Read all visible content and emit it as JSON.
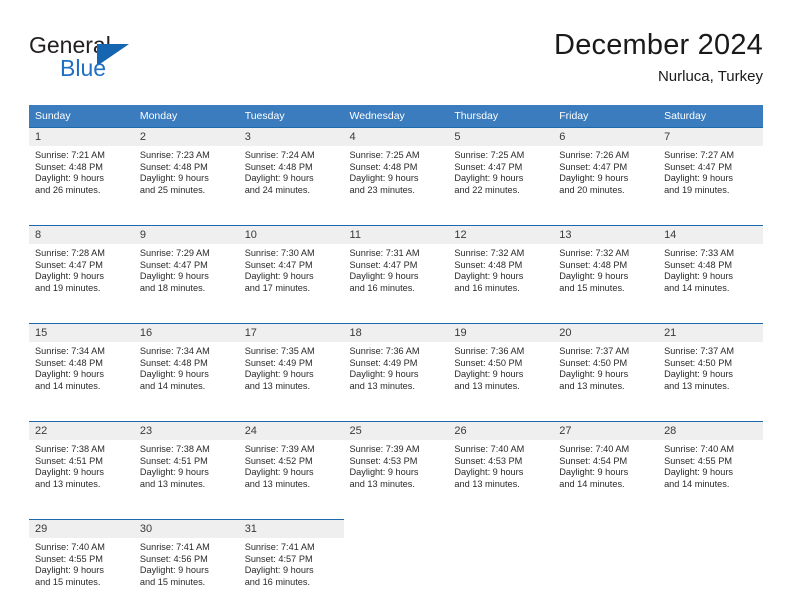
{
  "brand": {
    "name_part1": "General",
    "name_part2": "Blue",
    "flag_icon": "flag-triangle-icon"
  },
  "header": {
    "title": "December 2024",
    "location": "Nurluca, Turkey"
  },
  "colors": {
    "header_blue": "#3a7cbe",
    "cell_rule": "#1d69ad",
    "daynum_band": "#efefef",
    "brand_blue": "#1f6fc4",
    "text": "#1a1a1a"
  },
  "weekdays": [
    "Sunday",
    "Monday",
    "Tuesday",
    "Wednesday",
    "Thursday",
    "Friday",
    "Saturday"
  ],
  "labels": {
    "sunrise_prefix": "Sunrise:",
    "sunset_prefix": "Sunset:",
    "daylight_prefix": "Daylight:"
  },
  "weeks": [
    [
      {
        "day": "1",
        "sunrise": "Sunrise: 7:21 AM",
        "sunset": "Sunset: 4:48 PM",
        "daylight1": "Daylight: 9 hours",
        "daylight2": "and 26 minutes."
      },
      {
        "day": "2",
        "sunrise": "Sunrise: 7:23 AM",
        "sunset": "Sunset: 4:48 PM",
        "daylight1": "Daylight: 9 hours",
        "daylight2": "and 25 minutes."
      },
      {
        "day": "3",
        "sunrise": "Sunrise: 7:24 AM",
        "sunset": "Sunset: 4:48 PM",
        "daylight1": "Daylight: 9 hours",
        "daylight2": "and 24 minutes."
      },
      {
        "day": "4",
        "sunrise": "Sunrise: 7:25 AM",
        "sunset": "Sunset: 4:48 PM",
        "daylight1": "Daylight: 9 hours",
        "daylight2": "and 23 minutes."
      },
      {
        "day": "5",
        "sunrise": "Sunrise: 7:25 AM",
        "sunset": "Sunset: 4:47 PM",
        "daylight1": "Daylight: 9 hours",
        "daylight2": "and 22 minutes."
      },
      {
        "day": "6",
        "sunrise": "Sunrise: 7:26 AM",
        "sunset": "Sunset: 4:47 PM",
        "daylight1": "Daylight: 9 hours",
        "daylight2": "and 20 minutes."
      },
      {
        "day": "7",
        "sunrise": "Sunrise: 7:27 AM",
        "sunset": "Sunset: 4:47 PM",
        "daylight1": "Daylight: 9 hours",
        "daylight2": "and 19 minutes."
      }
    ],
    [
      {
        "day": "8",
        "sunrise": "Sunrise: 7:28 AM",
        "sunset": "Sunset: 4:47 PM",
        "daylight1": "Daylight: 9 hours",
        "daylight2": "and 19 minutes."
      },
      {
        "day": "9",
        "sunrise": "Sunrise: 7:29 AM",
        "sunset": "Sunset: 4:47 PM",
        "daylight1": "Daylight: 9 hours",
        "daylight2": "and 18 minutes."
      },
      {
        "day": "10",
        "sunrise": "Sunrise: 7:30 AM",
        "sunset": "Sunset: 4:47 PM",
        "daylight1": "Daylight: 9 hours",
        "daylight2": "and 17 minutes."
      },
      {
        "day": "11",
        "sunrise": "Sunrise: 7:31 AM",
        "sunset": "Sunset: 4:47 PM",
        "daylight1": "Daylight: 9 hours",
        "daylight2": "and 16 minutes."
      },
      {
        "day": "12",
        "sunrise": "Sunrise: 7:32 AM",
        "sunset": "Sunset: 4:48 PM",
        "daylight1": "Daylight: 9 hours",
        "daylight2": "and 16 minutes."
      },
      {
        "day": "13",
        "sunrise": "Sunrise: 7:32 AM",
        "sunset": "Sunset: 4:48 PM",
        "daylight1": "Daylight: 9 hours",
        "daylight2": "and 15 minutes."
      },
      {
        "day": "14",
        "sunrise": "Sunrise: 7:33 AM",
        "sunset": "Sunset: 4:48 PM",
        "daylight1": "Daylight: 9 hours",
        "daylight2": "and 14 minutes."
      }
    ],
    [
      {
        "day": "15",
        "sunrise": "Sunrise: 7:34 AM",
        "sunset": "Sunset: 4:48 PM",
        "daylight1": "Daylight: 9 hours",
        "daylight2": "and 14 minutes."
      },
      {
        "day": "16",
        "sunrise": "Sunrise: 7:34 AM",
        "sunset": "Sunset: 4:48 PM",
        "daylight1": "Daylight: 9 hours",
        "daylight2": "and 14 minutes."
      },
      {
        "day": "17",
        "sunrise": "Sunrise: 7:35 AM",
        "sunset": "Sunset: 4:49 PM",
        "daylight1": "Daylight: 9 hours",
        "daylight2": "and 13 minutes."
      },
      {
        "day": "18",
        "sunrise": "Sunrise: 7:36 AM",
        "sunset": "Sunset: 4:49 PM",
        "daylight1": "Daylight: 9 hours",
        "daylight2": "and 13 minutes."
      },
      {
        "day": "19",
        "sunrise": "Sunrise: 7:36 AM",
        "sunset": "Sunset: 4:50 PM",
        "daylight1": "Daylight: 9 hours",
        "daylight2": "and 13 minutes."
      },
      {
        "day": "20",
        "sunrise": "Sunrise: 7:37 AM",
        "sunset": "Sunset: 4:50 PM",
        "daylight1": "Daylight: 9 hours",
        "daylight2": "and 13 minutes."
      },
      {
        "day": "21",
        "sunrise": "Sunrise: 7:37 AM",
        "sunset": "Sunset: 4:50 PM",
        "daylight1": "Daylight: 9 hours",
        "daylight2": "and 13 minutes."
      }
    ],
    [
      {
        "day": "22",
        "sunrise": "Sunrise: 7:38 AM",
        "sunset": "Sunset: 4:51 PM",
        "daylight1": "Daylight: 9 hours",
        "daylight2": "and 13 minutes."
      },
      {
        "day": "23",
        "sunrise": "Sunrise: 7:38 AM",
        "sunset": "Sunset: 4:51 PM",
        "daylight1": "Daylight: 9 hours",
        "daylight2": "and 13 minutes."
      },
      {
        "day": "24",
        "sunrise": "Sunrise: 7:39 AM",
        "sunset": "Sunset: 4:52 PM",
        "daylight1": "Daylight: 9 hours",
        "daylight2": "and 13 minutes."
      },
      {
        "day": "25",
        "sunrise": "Sunrise: 7:39 AM",
        "sunset": "Sunset: 4:53 PM",
        "daylight1": "Daylight: 9 hours",
        "daylight2": "and 13 minutes."
      },
      {
        "day": "26",
        "sunrise": "Sunrise: 7:40 AM",
        "sunset": "Sunset: 4:53 PM",
        "daylight1": "Daylight: 9 hours",
        "daylight2": "and 13 minutes."
      },
      {
        "day": "27",
        "sunrise": "Sunrise: 7:40 AM",
        "sunset": "Sunset: 4:54 PM",
        "daylight1": "Daylight: 9 hours",
        "daylight2": "and 14 minutes."
      },
      {
        "day": "28",
        "sunrise": "Sunrise: 7:40 AM",
        "sunset": "Sunset: 4:55 PM",
        "daylight1": "Daylight: 9 hours",
        "daylight2": "and 14 minutes."
      }
    ],
    [
      {
        "day": "29",
        "sunrise": "Sunrise: 7:40 AM",
        "sunset": "Sunset: 4:55 PM",
        "daylight1": "Daylight: 9 hours",
        "daylight2": "and 15 minutes."
      },
      {
        "day": "30",
        "sunrise": "Sunrise: 7:41 AM",
        "sunset": "Sunset: 4:56 PM",
        "daylight1": "Daylight: 9 hours",
        "daylight2": "and 15 minutes."
      },
      {
        "day": "31",
        "sunrise": "Sunrise: 7:41 AM",
        "sunset": "Sunset: 4:57 PM",
        "daylight1": "Daylight: 9 hours",
        "daylight2": "and 16 minutes."
      },
      {
        "day": "",
        "sunrise": "",
        "sunset": "",
        "daylight1": "",
        "daylight2": ""
      },
      {
        "day": "",
        "sunrise": "",
        "sunset": "",
        "daylight1": "",
        "daylight2": ""
      },
      {
        "day": "",
        "sunrise": "",
        "sunset": "",
        "daylight1": "",
        "daylight2": ""
      },
      {
        "day": "",
        "sunrise": "",
        "sunset": "",
        "daylight1": "",
        "daylight2": ""
      }
    ]
  ]
}
